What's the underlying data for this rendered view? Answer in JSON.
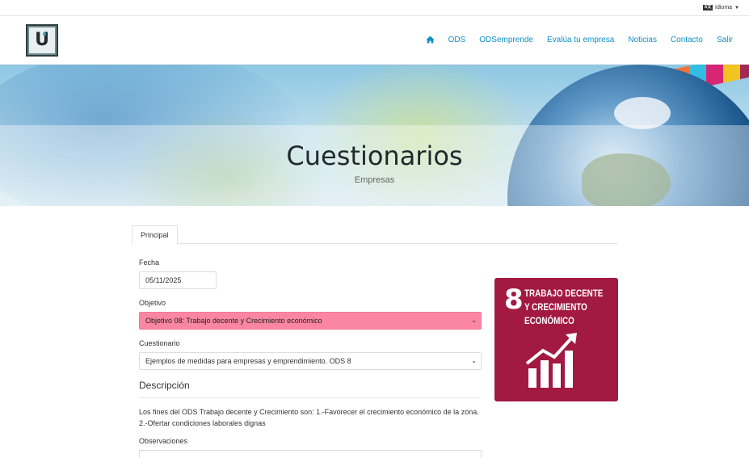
{
  "topbar": {
    "lang_icon": "A文",
    "language_label": "Idioma"
  },
  "logo": {
    "letter": "U"
  },
  "nav": {
    "items": [
      {
        "label": "ODS"
      },
      {
        "label": "ODSemprende"
      },
      {
        "label": "Evalúa tu empresa"
      },
      {
        "label": "Noticias"
      },
      {
        "label": "Contacto"
      },
      {
        "label": "Salir"
      }
    ],
    "home_icon": "home-icon"
  },
  "hero": {
    "title": "Cuestionarios",
    "subtitle": "Empresas"
  },
  "tabs": [
    {
      "label": "Principal",
      "active": true
    }
  ],
  "form": {
    "fecha_label": "Fecha",
    "fecha_value": "05/11/2025",
    "objetivo_label": "Objetivo",
    "objetivo_value": "Objetivo 08: Trabajo decente y Crecimiento económico",
    "cuestionario_label": "Cuestionario",
    "cuestionario_value": "Ejemplos de medidas para empresas y emprendimiento. ODS 8",
    "descripcion_title": "Descripción",
    "descripcion_text": "Los fines del ODS Trabajo decente y Crecimiento son: 1.-Favorecer el crecimiento económico de la zona. 2.-Ofertar condiciones laborales dignas",
    "observaciones_label": "Observaciones"
  },
  "sdg_card": {
    "number": "8",
    "line1": "TRABAJO DECENTE",
    "line2": "Y CRECIMIENTO",
    "line3": "ECONÓMICO",
    "color": "#a21942",
    "icon": "growth-chart-icon"
  },
  "colors": {
    "nav_link": "#0f8fc7",
    "objetivo_select": "#fb86a4"
  }
}
